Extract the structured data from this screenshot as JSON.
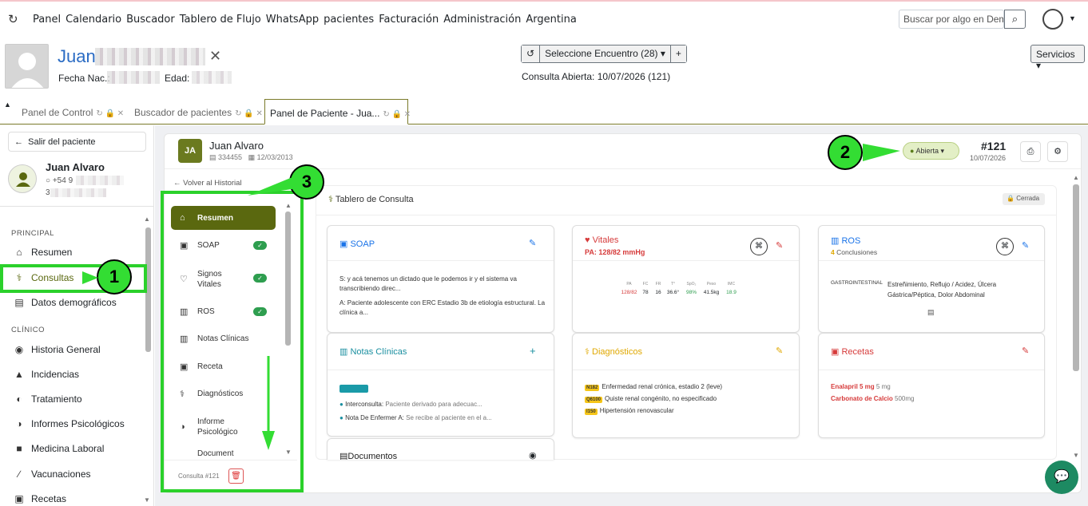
{
  "nav": {
    "items": [
      "Panel",
      "Calendario",
      "Buscador",
      "Tablero de Flujo",
      "WhatsApp",
      "pacientes",
      "Facturación",
      "Administración",
      "Argentina"
    ],
    "search_placeholder": "Buscar por algo en Demog"
  },
  "patient_header": {
    "name": "Juan",
    "fecha_label": "Fecha Nac.:",
    "edad_label": "Edad:",
    "encounter_button": "Seleccione Encuentro",
    "encounter_count": "(28)",
    "consulta_abierta": "Consulta Abierta: 10/07/2026 (121)",
    "servicios": "Servicios"
  },
  "tabs": [
    {
      "label": "Panel de Control"
    },
    {
      "label": "Buscador de pacientes"
    },
    {
      "label": "Panel de Paciente - Jua..."
    }
  ],
  "sidebar": {
    "back_label": "Salir del paciente",
    "patient_name": "Juan Alvaro",
    "phone": "+54 9",
    "doc": "3",
    "section_principal": "PRINCIPAL",
    "principal_items": [
      "Resumen",
      "Consultas",
      "Datos demográficos"
    ],
    "section_clinico": "CLÍNICO",
    "clinico_items": [
      "Historia General",
      "Incidencias",
      "Tratamiento",
      "Informes Psicológicos",
      "Medicina Laboral",
      "Vacunaciones",
      "Recetas"
    ]
  },
  "consulta": {
    "initials": "JA",
    "name": "Juan Alvaro",
    "id": "334455",
    "date": "12/03/2013",
    "status": "Abierta",
    "number": "#121",
    "number_date": "10/07/2026",
    "volver": "Volver al Historial",
    "footer": "Consulta #121"
  },
  "left_nav": [
    {
      "label": "Resumen",
      "check": false
    },
    {
      "label": "SOAP",
      "check": true
    },
    {
      "label": "Signos Vitales",
      "check": true
    },
    {
      "label": "ROS",
      "check": true
    },
    {
      "label": "Notas Clínicas",
      "check": false
    },
    {
      "label": "Receta",
      "check": false
    },
    {
      "label": "Diagnósticos",
      "check": false
    },
    {
      "label": "Informe Psicológico",
      "check": false
    },
    {
      "label": "Document",
      "check": false
    }
  ],
  "tablero": {
    "title": "Tablero de Consulta",
    "cerrada": "Cerrada",
    "soap": {
      "title": "SOAP",
      "s": "S: y acá tenemos un dictado que le podemos ir y el sistema va transcribiendo direc...",
      "a": "A: Paciente adolescente con ERC Estadio 3b de etiología estructural. La clínica a..."
    },
    "vitales": {
      "title": "Vitales",
      "pa": "PA: 128/82 mmHg",
      "headers": [
        "PA",
        "FC",
        "FR",
        "T°",
        "SpO₂",
        "Peso",
        "IMC"
      ],
      "values": [
        "128/82",
        "78",
        "16",
        "36.6°",
        "98%",
        "41.5kg",
        "18.9"
      ]
    },
    "ros": {
      "title": "ROS",
      "count": "4",
      "count_label": "Conclusiones",
      "system": "GASTROINTESTINAL",
      "findings": "Estreñimiento, Reflujo / Acidez, Úlcera Gástrica/Péptica, Dolor Abdominal"
    },
    "notas": {
      "title": "Notas Clínicas",
      "n1_label": "Interconsulta:",
      "n1_text": "Paciente derivado para adecuac...",
      "n2_label": "Nota De Enfermer A:",
      "n2_text": "Se recibe al paciente en el a..."
    },
    "diagnosticos": {
      "title": "Diagnósticos",
      "items": [
        {
          "code": "N182",
          "text": "Enfermedad renal crónica, estadio 2 (leve)"
        },
        {
          "code": "Q6100",
          "text": "Quiste renal congénito, no especificado"
        },
        {
          "code": "I150",
          "text": "Hipertensión renovascular"
        }
      ]
    },
    "recetas": {
      "title": "Recetas",
      "items": [
        {
          "drug": "Enalapril 5 mg",
          "dose": "5 mg"
        },
        {
          "drug": "Carbonato de Calcio",
          "dose": "500mg"
        }
      ]
    },
    "documentos": {
      "title": "Documentos"
    }
  },
  "annotations": [
    "1",
    "2",
    "3"
  ],
  "colors": {
    "brand_olive": "#5a680f",
    "link_blue": "#2b6cc4",
    "highlight_green": "#33dd33"
  }
}
